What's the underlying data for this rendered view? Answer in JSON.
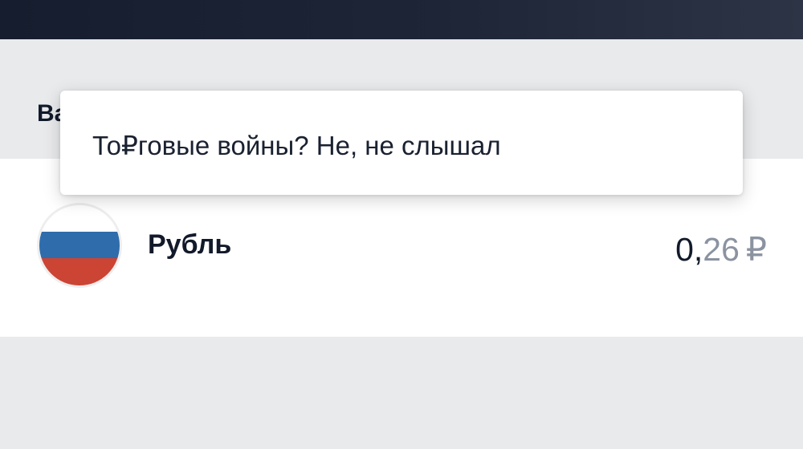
{
  "section": {
    "title": "Ва"
  },
  "currency": {
    "name": "Рубль",
    "value_integer": "0,",
    "value_fraction": "26",
    "symbol": "₽",
    "flag_icon": "russia-flag-icon",
    "flag_colors": [
      "#ffffff",
      "#2f6cab",
      "#cc4434"
    ]
  },
  "tooltip": {
    "text": "То₽говые войны? Не, не слышал"
  },
  "colors": {
    "topbar": "#151d2e",
    "background": "#e9eaec",
    "text_primary": "#121a2a",
    "text_secondary": "#8b93a1"
  }
}
